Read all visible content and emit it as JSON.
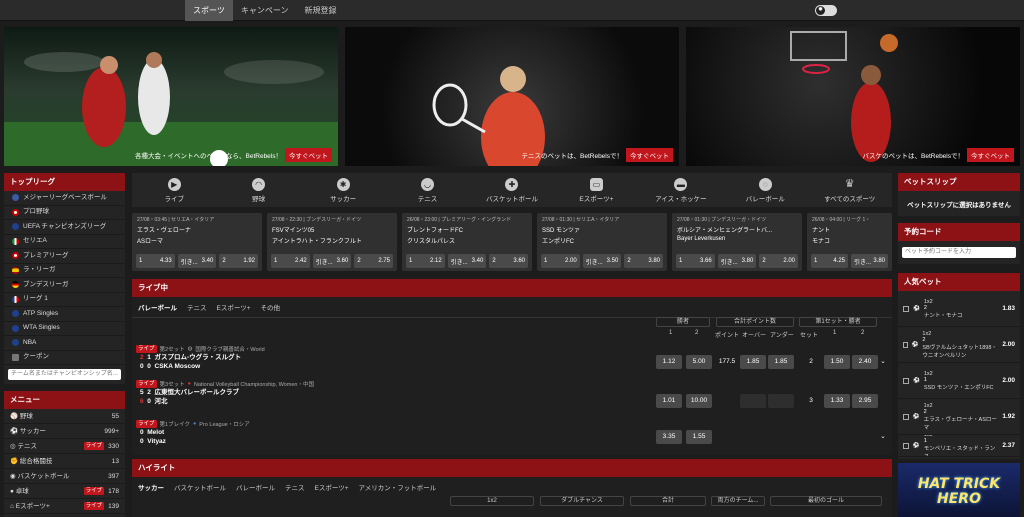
{
  "topnav": {
    "items": [
      "スポーツ",
      "キャンペーン",
      "新規登録"
    ]
  },
  "banners": [
    {
      "caption": "各種大会・イベントへのベットなら、BetRebels！",
      "button": "今すぐベット"
    },
    {
      "caption": "テニスのベットは、BetRebelsで！",
      "button": "今すぐベット"
    },
    {
      "caption": "バスケのベットは、BetRebelsで！",
      "button": "今すぐベット"
    }
  ],
  "top_leagues": {
    "title": "トップリーグ",
    "items": [
      "メジャーリーグベースボール",
      "プロ野球",
      "UEFA チャンピオンズリーグ",
      "セリエA",
      "プレミアリーグ",
      "ラ・リーガ",
      "ブンデスリーガ",
      "リーグ 1",
      "ATP Singles",
      "WTA Singles",
      "NBA",
      "クーポン"
    ],
    "search_placeholder": "チーム名またはチャンピオンシップ名..."
  },
  "menu": {
    "title": "メニュー",
    "items": [
      {
        "label": "野球",
        "count": "55",
        "live": ""
      },
      {
        "label": "サッカー",
        "count": "999+",
        "live": ""
      },
      {
        "label": "テニス",
        "count": "330",
        "live": "ライブ"
      },
      {
        "label": "総合格闘技",
        "count": "13",
        "live": ""
      },
      {
        "label": "バスケットボール",
        "count": "397",
        "live": ""
      },
      {
        "label": "卓球",
        "count": "178",
        "live": "ライブ"
      },
      {
        "label": "Eスポーツ+",
        "count": "139",
        "live": "ライブ"
      }
    ]
  },
  "sports_bar": [
    "ライブ",
    "野球",
    "サッカー",
    "テニス",
    "バスケットボール",
    "Eスポーツ+",
    "アイス・ホッケー",
    "バレーボール",
    "すべてのスポーツ"
  ],
  "cards": [
    {
      "meta": "27/08・03:45 | セリエA・イタリア",
      "home": "エラス・ヴェローナ",
      "away": "ASローマ",
      "o1": "4.33",
      "ox": "3.40",
      "o2": "1.92"
    },
    {
      "meta": "27/08・22:30 | ブンデスリーガ・ドイツ",
      "home": "FSVマインツ05",
      "away": "アイントラハト・フランクフルト",
      "o1": "2.42",
      "ox": "3.60",
      "o2": "2.75"
    },
    {
      "meta": "26/08・23:00 | プレミアリーグ・イングランド",
      "home": "ブレントフォードFC",
      "away": "クリスタルパレス",
      "o1": "2.12",
      "ox": "3.40",
      "o2": "3.60"
    },
    {
      "meta": "27/08・01:30 | セリエA・イタリア",
      "home": "SSD モンツァ",
      "away": "エンポリFC",
      "o1": "2.00",
      "ox": "3.50",
      "o2": "3.80"
    },
    {
      "meta": "27/08・01:30 | ブンデスリーガ・ドイツ",
      "home": "ボルシア・メンヒェングラートバ...",
      "away": "Bayer Leverkusen",
      "o1": "3.66",
      "ox": "3.80",
      "o2": "2.00"
    },
    {
      "meta": "26/08・04:00 | リーグ 1・",
      "home": "ナント",
      "away": "モナコ",
      "o1": "4.25",
      "ox": "3.80",
      "o2": ""
    }
  ],
  "card_labels": {
    "one": "1",
    "draw": "引き...",
    "two": "2",
    "live": "ライブ"
  },
  "live": {
    "title": "ライブ中",
    "tabs": [
      "バレーボール",
      "テニス",
      "Eスポーツ+",
      "その他"
    ],
    "groups": [
      "勝者",
      "合計ポイント数",
      "第1セット・勝者"
    ],
    "cols": [
      "1",
      "2",
      "ポイント",
      "オーバー",
      "アンダー",
      "セット",
      "1",
      "2"
    ],
    "events": [
      {
        "status": "ライブ",
        "period": "第2セット",
        "league": "国際クラブ親善試合・World",
        "s1": "2",
        "s2": "0",
        "g1": "1",
        "g2": "0",
        "home": "ガスプロム-ウグラ・スルグト",
        "away": "CSKA Moscow",
        "odds": [
          "1.12",
          "5.00",
          "177.5",
          "1.85",
          "1.85",
          "2",
          "1.50",
          "2.40"
        ]
      },
      {
        "status": "ライブ",
        "period": "第3セット",
        "league": "National Volleyball Championship, Women・中国",
        "s1": "5",
        "s2": "6",
        "g1": "2",
        "g2": "0",
        "home": "広東恒大バレーボールクラブ",
        "away": "河北",
        "odds": [
          "1.01",
          "10.00",
          "",
          "",
          "",
          "3",
          "1.33",
          "2.95"
        ]
      },
      {
        "status": "ライブ",
        "period": "第1ブレイク",
        "league": "Pro League・ロシア",
        "s1": "",
        "s2": "",
        "g1": "0",
        "g2": "0",
        "home": "Melot",
        "away": "Vityaz",
        "odds": [
          "3.35",
          "1.55",
          "",
          "",
          "",
          "",
          "",
          ""
        ]
      }
    ]
  },
  "highlights": {
    "title": "ハイライト",
    "tabs": [
      "サッカー",
      "バスケットボール",
      "バレーボール",
      "テニス",
      "Eスポーツ+",
      "アメリカン・フットボール"
    ],
    "groups": [
      "1x2",
      "ダブルチャンス",
      "合計",
      "両方のチーム...",
      "最初のゴール"
    ]
  },
  "betslip": {
    "title": "ベットスリップ",
    "empty": "ベットスリップに選択はありません"
  },
  "booking": {
    "title": "予約コード",
    "placeholder": "ベット予約コードを入力"
  },
  "popular": {
    "title": "人気ベット",
    "items": [
      {
        "market": "1x2",
        "pick": "2",
        "match": "ナント・モナコ",
        "odds": "1.83"
      },
      {
        "market": "1x2",
        "pick": "2",
        "match": "SBヴァルムシュタット1898・ウニオンベルリン",
        "odds": "2.00"
      },
      {
        "market": "1x2",
        "pick": "1",
        "match": "SSD モンツァ・エンポリFC",
        "odds": "2.00"
      },
      {
        "market": "1x2",
        "pick": "2",
        "match": "エラス・ヴェローナ・ASローマ",
        "odds": "1.92"
      },
      {
        "market": "1x2",
        "pick": "1",
        "match": "モンペリエ・スタッド・ランス",
        "odds": "2.37"
      }
    ]
  },
  "promo": {
    "text": "HAT TRICK HERO"
  }
}
